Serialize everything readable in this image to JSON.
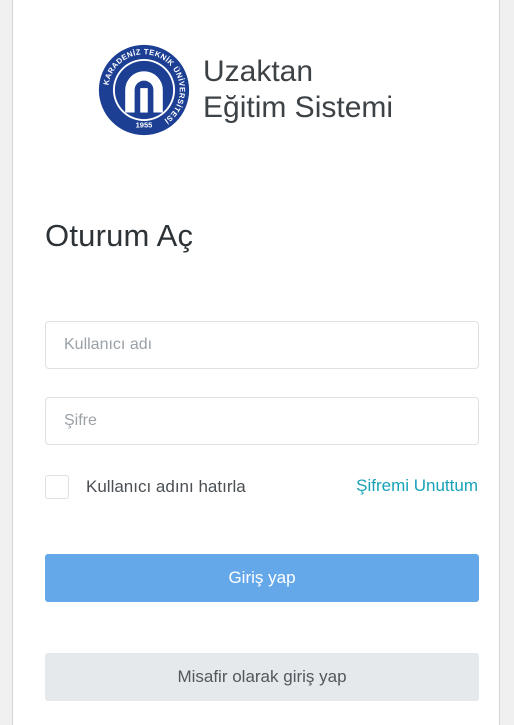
{
  "brand": {
    "logo_name": "karadeniz-technical-university-seal",
    "logo_ring_text": "KARADENİZ TEKNİK ÜNİVERSİTESİ",
    "logo_year": "1955",
    "title_line1": "Uzaktan",
    "title_line2": "Eğitim Sistemi",
    "logo_color": "#1c3f94"
  },
  "login": {
    "heading": "Oturum Aç",
    "username_placeholder": "Kullanıcı adı",
    "username_value": "",
    "password_placeholder": "Şifre",
    "password_value": "",
    "remember_label": "Kullanıcı adını hatırla",
    "remember_checked": false,
    "forgot_link": "Şifremi Unuttum",
    "submit_label": "Giriş yap",
    "guest_label": "Misafir olarak giriş yap"
  },
  "colors": {
    "primary_button": "#64a8ea",
    "secondary_button": "#e6e9ec",
    "link": "#17a2b8"
  }
}
